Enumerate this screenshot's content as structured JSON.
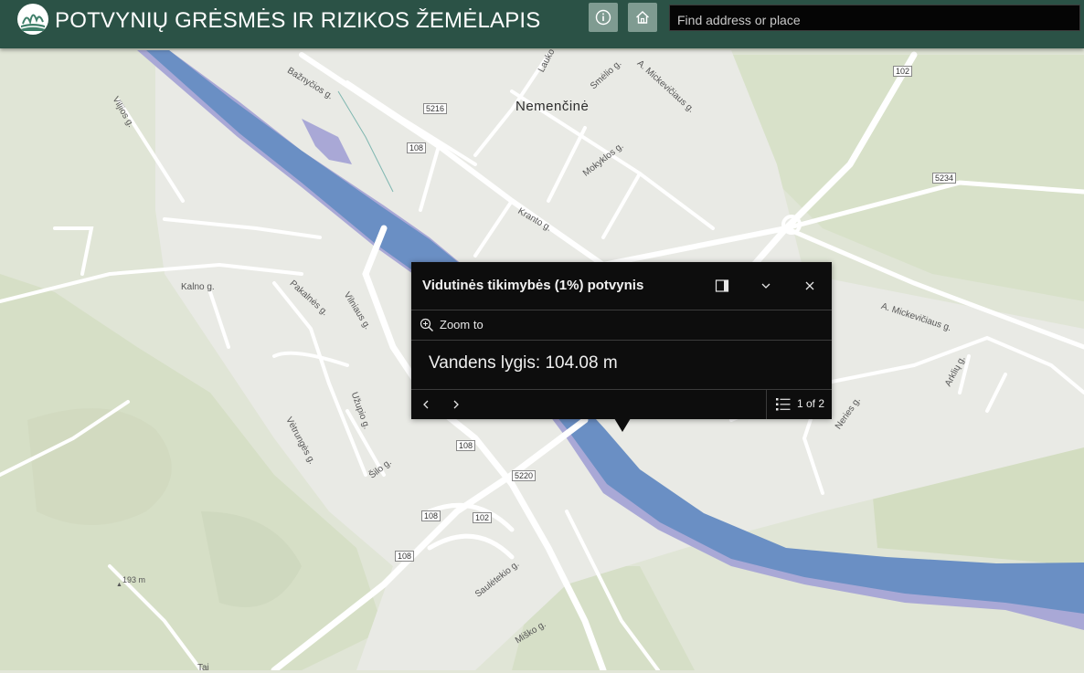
{
  "header": {
    "title": "POTVYNIŲ GRĖSMĖS IR RIZIKOS ŽEMĖLAPIS",
    "info_icon": "info-icon",
    "home_icon": "home-icon",
    "accent_color": "#2b5246"
  },
  "search": {
    "placeholder": "Find address or place"
  },
  "map": {
    "place_label": "Nemenčinė",
    "street_labels": [
      "Bažnyčios g.",
      "Lauko",
      "Smėlio g.",
      "A. Mickevičiaus g.",
      "Mokyklos g.",
      "Kranto g.",
      "Viljios g.",
      "Kalno g.",
      "Pakalnės g.",
      "Vilniaus g.",
      "Užupio g.",
      "Vėtrungės g.",
      "Šilo g.",
      "Saulėtekio g.",
      "Miško g.",
      "A. Mickevičiaus g.",
      "Arklių g.",
      "Neries g.",
      "Tai"
    ],
    "road_shields": [
      "5216",
      "108",
      "102",
      "5234",
      "108",
      "5220",
      "108",
      "102",
      "108"
    ],
    "elevation_label": "193 m",
    "river_color": "#6a8fc4",
    "flood_zone_color": "#a7a6d4"
  },
  "popup": {
    "title": "Vidutinės tikimybės (1%) potvynis",
    "zoom_to": "Zoom to",
    "content": "Vandens lygis: 104.08 m",
    "feature_count": "1 of 2"
  }
}
